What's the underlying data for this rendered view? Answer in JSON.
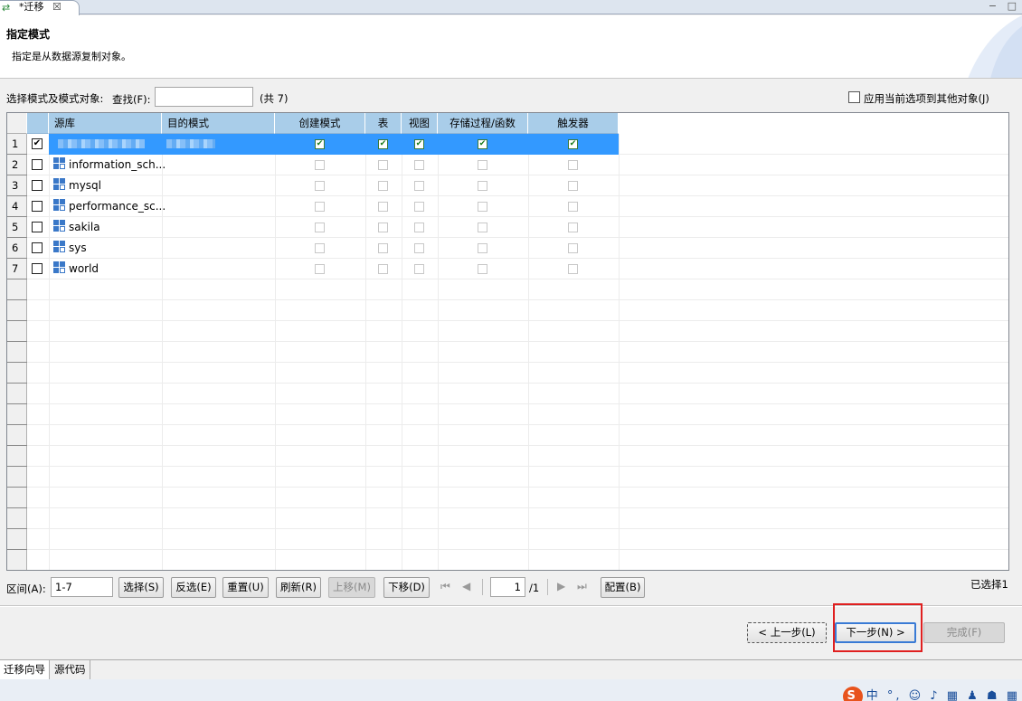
{
  "tab": {
    "title": "*迁移",
    "close": "☒"
  },
  "window_controls": {
    "minimize": "−",
    "maximize": "□"
  },
  "header": {
    "title": "指定模式",
    "description": "指定是从数据源复制对象。"
  },
  "toolbar": {
    "select_label": "选择模式及模式对象:",
    "find_label": "查找(F):",
    "find_value": "",
    "count_text": "(共 7)",
    "apply_label": "应用当前选项到其他对象(J)"
  },
  "grid": {
    "columns": [
      "源库",
      "目的模式",
      "创建模式",
      "表",
      "视图",
      "存储过程/函数",
      "触发器"
    ],
    "rows": [
      {
        "num": "1",
        "checked": true,
        "name": "",
        "target": "",
        "flags": [
          true,
          true,
          true,
          true,
          true
        ],
        "selected": true
      },
      {
        "num": "2",
        "checked": false,
        "name": "information_sch...",
        "target": "",
        "flags": [
          false,
          false,
          false,
          false,
          false
        ]
      },
      {
        "num": "3",
        "checked": false,
        "name": "mysql",
        "target": "",
        "flags": [
          false,
          false,
          false,
          false,
          false
        ]
      },
      {
        "num": "4",
        "checked": false,
        "name": "performance_sc...",
        "target": "",
        "flags": [
          false,
          false,
          false,
          false,
          false
        ]
      },
      {
        "num": "5",
        "checked": false,
        "name": "sakila",
        "target": "",
        "flags": [
          false,
          false,
          false,
          false,
          false
        ]
      },
      {
        "num": "6",
        "checked": false,
        "name": "sys",
        "target": "",
        "flags": [
          false,
          false,
          false,
          false,
          false
        ]
      },
      {
        "num": "7",
        "checked": false,
        "name": "world",
        "target": "",
        "flags": [
          false,
          false,
          false,
          false,
          false
        ]
      }
    ]
  },
  "bottom": {
    "range_label": "区间(A):",
    "range_value": "1-7",
    "select_btn": "选择(S)",
    "invert_btn": "反选(E)",
    "reset_btn": "重置(U)",
    "refresh_btn": "刷新(R)",
    "up_btn": "上移(M)",
    "down_btn": "下移(D)",
    "page_value": "1",
    "page_total": "/1",
    "config_btn": "配置(B)",
    "selected_count": "已选择1"
  },
  "wizard": {
    "back": "< 上一步(L)",
    "next": "下一步(N) >",
    "finish": "完成(F)"
  },
  "bottom_tabs": [
    "迁移向导",
    "源代码"
  ],
  "ime": {
    "logo": "S",
    "lang": "中",
    "icons": "°, ☺ ♪ ▦ ♟ ☗ ▦"
  }
}
